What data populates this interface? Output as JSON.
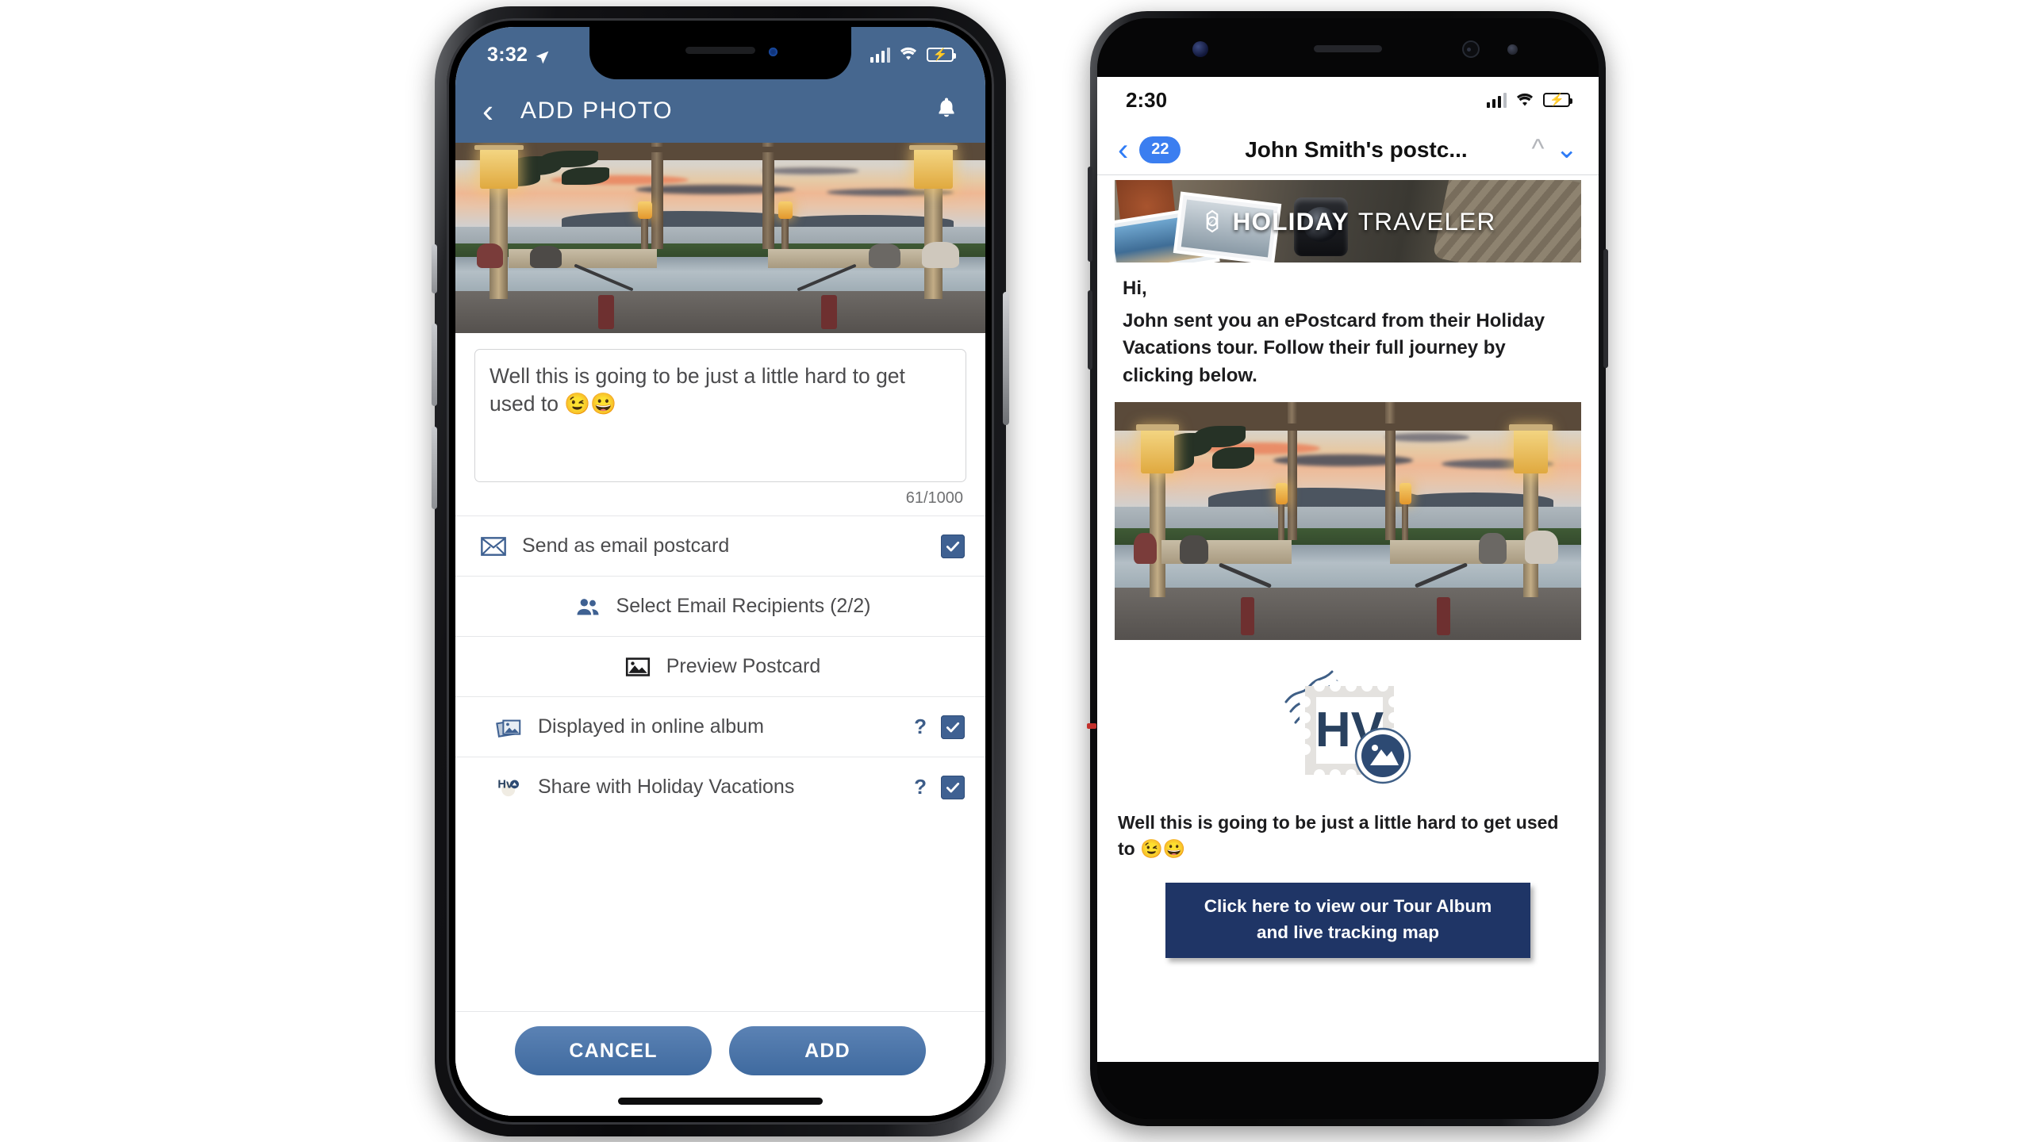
{
  "left_phone": {
    "device": "iphone",
    "status_bar": {
      "time": "3:32",
      "location_icon": "location-arrow-icon",
      "signal_icon": "cellular-bars-icon",
      "wifi_icon": "wifi-icon",
      "battery_icon": "battery-charging-icon"
    },
    "app_bar": {
      "back_icon": "chevron-left-icon",
      "title": "ADD PHOTO",
      "bell_icon": "bell-icon"
    },
    "photo": {
      "alt": "Sunset view over pool and ocean with tiki lamps"
    },
    "caption": {
      "value": "Well this is going to be just a little hard to get used to 😉😀",
      "counter": "61/1000"
    },
    "options": [
      {
        "icon": "envelope-icon",
        "label": "Send as email postcard",
        "help": false,
        "checkbox": true,
        "centered": true
      },
      {
        "icon": "people-icon",
        "label": "Select Email Recipients (2/2)",
        "help": false,
        "checkbox": false,
        "centered": true
      },
      {
        "icon": "image-icon",
        "label": "Preview Postcard",
        "help": false,
        "checkbox": false,
        "centered": true
      },
      {
        "icon": "photo-album-icon",
        "label": "Displayed in online album",
        "help": true,
        "checkbox": true,
        "centered": false
      },
      {
        "icon": "hv-logo-icon",
        "label": "Share with Holiday Vacations",
        "help": true,
        "checkbox": true,
        "centered": false
      }
    ],
    "help_symbol": "?",
    "buttons": {
      "cancel": "CANCEL",
      "add": "ADD"
    }
  },
  "right_phone": {
    "device": "android",
    "status_bar": {
      "time": "2:30",
      "signal_icon": "cellular-bars-icon",
      "wifi_icon": "wifi-icon",
      "battery_icon": "battery-charging-icon"
    },
    "mail_bar": {
      "back_icon": "chevron-left-icon",
      "unread_badge": "22",
      "title": "John Smith's postc...",
      "prev_icon": "chevron-up-icon",
      "next_icon": "chevron-down-icon"
    },
    "banner": {
      "logo_icon": "compass-icon",
      "word1": "HOLIDAY",
      "word2": "TRAVELER"
    },
    "message": {
      "greeting": "Hi,",
      "body": "John sent you an ePostcard from their Holiday Vacations tour. Follow their full journey by clicking below."
    },
    "photo": {
      "alt": "Sunset view over pool and ocean with tiki lamps"
    },
    "stamp": {
      "icon": "postage-stamp-icon",
      "initials": "HV",
      "seal_icon": "circular-seal-icon"
    },
    "postcard_text": "Well this is going to be just a little hard to get used to 😉😀",
    "cta": {
      "line1": "Click here to view our Tour Album",
      "line2": "and live tracking map"
    }
  },
  "colors": {
    "ios_header_blue": "#46678f",
    "button_blue": "#4a74a8",
    "checkbox_blue": "#3f6192",
    "cta_navy": "#1f3566",
    "badge_blue": "#3b7ef0",
    "link_blue": "#2f7cf6",
    "stamp_navy": "#29415f"
  }
}
